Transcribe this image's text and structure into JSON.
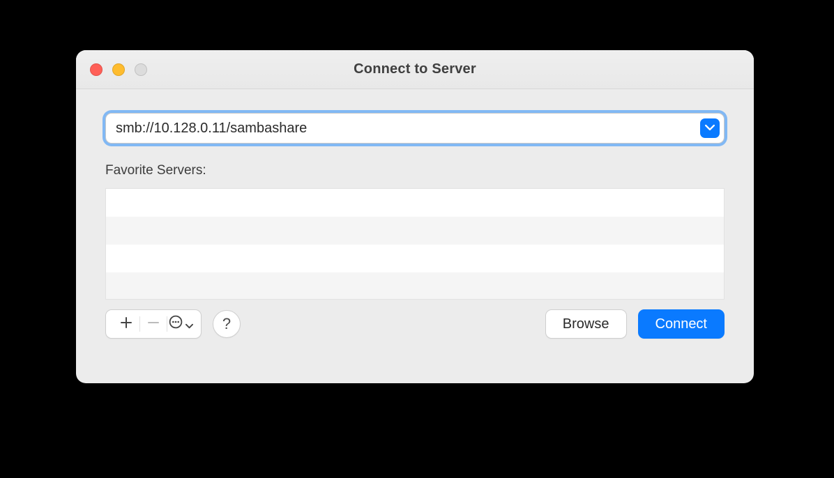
{
  "window": {
    "title": "Connect to Server"
  },
  "address": {
    "value": "smb://10.128.0.11/sambashare"
  },
  "favorites": {
    "label": "Favorite Servers:",
    "items": []
  },
  "toolbar": {
    "add_tooltip": "Add",
    "remove_tooltip": "Remove",
    "more_tooltip": "More",
    "help_tooltip": "Help"
  },
  "buttons": {
    "browse": "Browse",
    "connect": "Connect"
  },
  "colors": {
    "accent": "#0a7aff"
  }
}
